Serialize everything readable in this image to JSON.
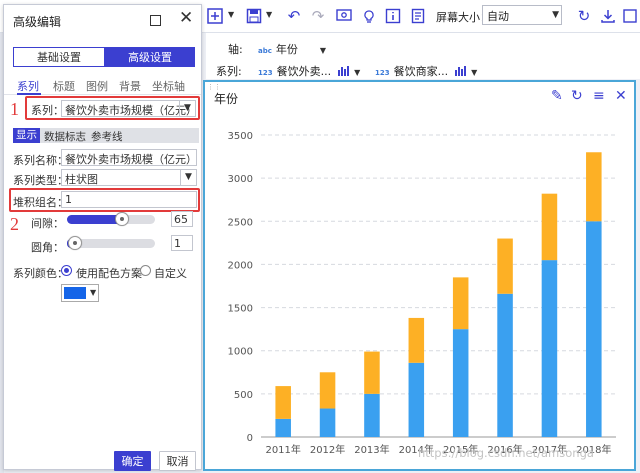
{
  "toolbar": {
    "screen_size_label": "屏幕大小：",
    "screen_size_value": "自动"
  },
  "axis": {
    "label": "轴:",
    "badge": "abc",
    "field": "年份"
  },
  "series_bar": {
    "label": "系列:",
    "badge": "123",
    "fields": [
      "餐饮外卖...",
      "餐饮商家..."
    ]
  },
  "dialog": {
    "title": "高级编辑",
    "seg_basic": "基础设置",
    "seg_advanced": "高级设置",
    "tabs": [
      "系列",
      "标题",
      "图例",
      "背景",
      "坐标轴"
    ],
    "series_select_label": "系列：",
    "series_select_value": "餐饮外卖市场规模（亿元）",
    "subtabs": [
      "显示",
      "数据标志",
      "参考线"
    ],
    "series_name_label": "系列名称：",
    "series_name_value": "餐饮外卖市场规模（亿元）",
    "series_type_label": "系列类型：",
    "series_type_value": "柱状图",
    "stack_group_label": "堆积组名：",
    "stack_group_value": "1",
    "gap_label": "间隙：",
    "gap_value": "65",
    "gap_fraction": 0.65,
    "corner_label": "圆角：",
    "corner_value": "1",
    "corner_fraction": 0.01,
    "color_label": "系列颜色：",
    "color_option_scheme": "使用配色方案",
    "color_option_custom": "自定义",
    "color_swatch": "#1565e8",
    "ok_label": "确定",
    "cancel_label": "取消",
    "annotation_1": "1",
    "annotation_2": "2"
  },
  "chart_panel": {
    "title": "年份"
  },
  "chart_data": {
    "type": "bar",
    "stacked": true,
    "categories": [
      "2011年",
      "2012年",
      "2013年",
      "2014年",
      "2015年",
      "2016年",
      "2017年",
      "2018年"
    ],
    "series": [
      {
        "color": "#3aa0f0",
        "values": [
          210,
          330,
          500,
          860,
          1250,
          1660,
          2050,
          2500
        ]
      },
      {
        "color": "#fdb025",
        "values": [
          380,
          420,
          490,
          520,
          600,
          640,
          770,
          800
        ]
      }
    ],
    "ylim": [
      0,
      3500
    ],
    "yticks": [
      0,
      500,
      1000,
      1500,
      2000,
      2500,
      3000,
      3500
    ],
    "grid": true
  },
  "watermark": "https://blog.csdn.net/amsonga"
}
